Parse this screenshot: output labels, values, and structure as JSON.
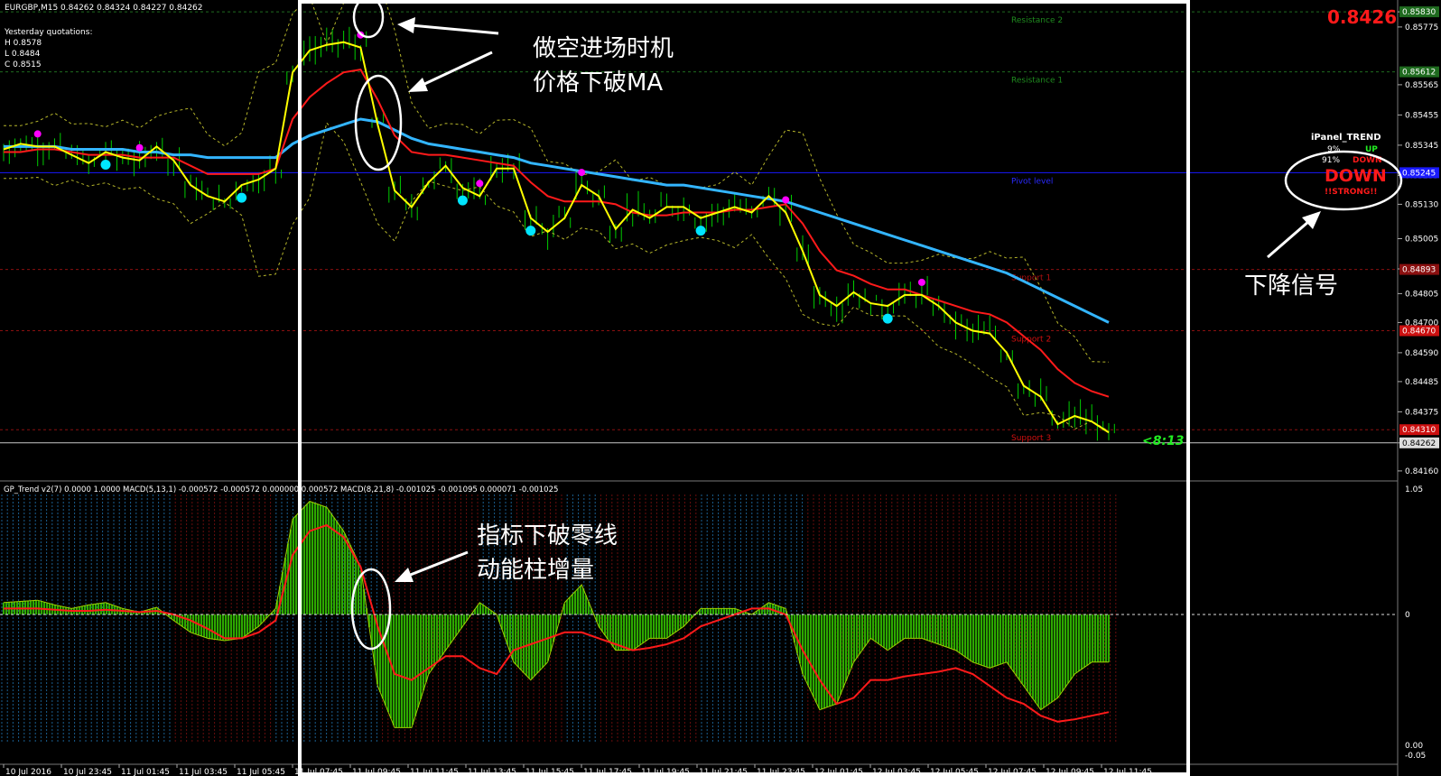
{
  "header": {
    "symbol_line": "EURGBP,M15  0.84262 0.84324 0.84227 0.84262",
    "yesterday_title": "Yesterday quotations:",
    "yesterday_h": "H 0.8578",
    "yesterday_l": "L 0.8484",
    "yesterday_c": "C 0.8515"
  },
  "price_panel": {
    "current_price_big": "0.8426",
    "countdown": "<8:13",
    "axis_ticks": [
      "0.85830",
      "0.85775",
      "0.85565",
      "0.85455",
      "0.85345",
      "0.85235",
      "0.85130",
      "0.85005",
      "0.84895",
      "0.84805",
      "0.84700",
      "0.84590",
      "0.84485",
      "0.84375",
      "0.84262",
      "0.84160"
    ],
    "axis_highlight_labels": [
      "0.85830",
      "0.85612",
      "0.85245",
      "0.84893",
      "0.84670",
      "0.84310",
      "0.84262"
    ],
    "levels": [
      {
        "name": "Resistance 2",
        "value": 0.8583,
        "color": "#1f6b1f",
        "label_color": "#1f8a1f",
        "line": "dashed"
      },
      {
        "name": "Resistance 1",
        "value": 0.85612,
        "color": "#1f6b1f",
        "label_color": "#1f8a1f",
        "line": "dashed"
      },
      {
        "name": "Pivot level",
        "value": 0.85245,
        "color": "#1a1aff",
        "label_color": "#2a2aff",
        "line": "solid"
      },
      {
        "name": "Support 1",
        "value": 0.84893,
        "color": "#8a1010",
        "label_color": "#b01010",
        "line": "dashed"
      },
      {
        "name": "Support 2",
        "value": 0.8467,
        "color": "#8a1010",
        "label_color": "#d01010",
        "line": "dashed"
      },
      {
        "name": "Support 3",
        "value": 0.8431,
        "color": "#8a1010",
        "label_color": "#d01010",
        "line": "dashed"
      }
    ],
    "current_price_value": 0.84262
  },
  "ipanel": {
    "title": "iPanel_TREND",
    "up_pct": "9%",
    "up_label": "UP",
    "down_pct": "91%",
    "down_label": "DOWN",
    "big_signal": "DOWN",
    "strength": "!!STRONG!!"
  },
  "annotations": {
    "entry_line1": "做空进场时机",
    "entry_line2": "价格下破MA",
    "signal": "下降信号",
    "macd_line1": "指标下破零线",
    "macd_line2": "动能柱增量"
  },
  "macd_panel": {
    "title": "GP_Trend v2(7) 0.0000 1.0000  MACD(5,13,1) -0.000572 -0.000572 0.000000 0.000572  MACD(8,21,8) -0.001025 -0.001095 0.000071 -0.001025",
    "axis_labels": [
      "1.05",
      "0",
      "0.00",
      "-0.05"
    ]
  },
  "time_axis": [
    "10 Jul 2016",
    "10 Jul 23:45",
    "11 Jul 01:45",
    "11 Jul 03:45",
    "11 Jul 05:45",
    "11 Jul 07:45",
    "11 Jul 09:45",
    "11 Jul 11:45",
    "11 Jul 13:45",
    "11 Jul 15:45",
    "11 Jul 17:45",
    "11 Jul 19:45",
    "11 Jul 21:45",
    "11 Jul 23:45",
    "12 Jul 01:45",
    "12 Jul 03:45",
    "12 Jul 05:45",
    "12 Jul 07:45",
    "12 Jul 09:45",
    "12 Jul 11:45"
  ],
  "chart_data": {
    "type": "line",
    "symbol": "EURGBP",
    "timeframe": "M15",
    "ylim": [
      0.8414,
      0.8586
    ],
    "series": [
      {
        "values": [
          0.8533,
          0.8535,
          0.8534,
          0.8534,
          0.8531,
          0.8528,
          0.8532,
          0.853,
          0.8529,
          0.8534,
          0.8529,
          0.852,
          0.8516,
          0.8514,
          0.852,
          0.8522,
          0.8526,
          0.8561,
          0.8569,
          0.8571,
          0.8572,
          0.857,
          0.8542,
          0.8518,
          0.8512,
          0.8521,
          0.8527,
          0.8519,
          0.8516,
          0.8526,
          0.8526,
          0.8508,
          0.8503,
          0.8508,
          0.852,
          0.8516,
          0.8504,
          0.8511,
          0.8508,
          0.8512,
          0.8512,
          0.8508,
          0.851,
          0.8512,
          0.851,
          0.8516,
          0.851,
          0.8496,
          0.848,
          0.8476,
          0.8481,
          0.8477,
          0.8476,
          0.848,
          0.848,
          0.8476,
          0.847,
          0.8467,
          0.8466,
          0.8459,
          0.8447,
          0.8443,
          0.8433,
          0.8436,
          0.8434,
          0.843
        ]
      },
      {
        "values": [
          0.8532,
          0.8532,
          0.8533,
          0.8533,
          0.8532,
          0.8531,
          0.8531,
          0.8531,
          0.853,
          0.853,
          0.853,
          0.8527,
          0.8524,
          0.8524,
          0.8524,
          0.8524,
          0.8526,
          0.8544,
          0.8552,
          0.8557,
          0.8561,
          0.8562,
          0.8551,
          0.8538,
          0.8532,
          0.8531,
          0.8531,
          0.853,
          0.8529,
          0.8528,
          0.8527,
          0.8521,
          0.8516,
          0.8514,
          0.8514,
          0.8514,
          0.8513,
          0.851,
          0.8509,
          0.8509,
          0.851,
          0.851,
          0.851,
          0.8511,
          0.8511,
          0.8512,
          0.8513,
          0.8506,
          0.8496,
          0.8489,
          0.8487,
          0.8484,
          0.8482,
          0.8482,
          0.848,
          0.8478,
          0.8476,
          0.8474,
          0.8473,
          0.847,
          0.8465,
          0.846,
          0.8453,
          0.8448,
          0.8445,
          0.8443
        ]
      },
      {
        "values": [
          0.8534,
          0.8534,
          0.8534,
          0.8534,
          0.8533,
          0.8533,
          0.8533,
          0.8533,
          0.8532,
          0.8532,
          0.8531,
          0.8531,
          0.853,
          0.853,
          0.853,
          0.853,
          0.853,
          0.8535,
          0.8538,
          0.854,
          0.8542,
          0.8544,
          0.8543,
          0.854,
          0.8537,
          0.8535,
          0.8534,
          0.8533,
          0.8532,
          0.8531,
          0.853,
          0.8528,
          0.8527,
          0.8526,
          0.8525,
          0.8524,
          0.8523,
          0.8522,
          0.8521,
          0.852,
          0.852,
          0.8519,
          0.8518,
          0.8517,
          0.8516,
          0.8515,
          0.8514,
          0.8512,
          0.851,
          0.8508,
          0.8506,
          0.8504,
          0.8502,
          0.85,
          0.8498,
          0.8496,
          0.8494,
          0.8492,
          0.849,
          0.8488,
          0.8485,
          0.8482,
          0.8479,
          0.8476,
          0.8473,
          0.847
        ]
      },
      {
        "values": [
          0.1,
          0.11,
          0.12,
          0.08,
          0.05,
          0.08,
          0.1,
          0.05,
          0.02,
          0.06,
          -0.05,
          -0.15,
          -0.2,
          -0.22,
          -0.2,
          -0.1,
          0.05,
          0.8,
          0.95,
          0.9,
          0.7,
          0.4,
          -0.6,
          -0.95,
          -0.95,
          -0.5,
          -0.3,
          -0.1,
          0.1,
          0.0,
          -0.4,
          -0.55,
          -0.4,
          0.1,
          0.25,
          -0.1,
          -0.3,
          -0.3,
          -0.2,
          -0.2,
          -0.1,
          0.05,
          0.05,
          0.05,
          0.0,
          0.1,
          0.05,
          -0.5,
          -0.8,
          -0.75,
          -0.4,
          -0.2,
          -0.3,
          -0.2,
          -0.2,
          -0.25,
          -0.3,
          -0.4,
          -0.45,
          -0.4,
          -0.6,
          -0.8,
          -0.7,
          -0.5,
          -0.4,
          -0.4
        ]
      },
      {
        "values": [
          0.05,
          0.05,
          0.05,
          0.04,
          0.03,
          0.03,
          0.04,
          0.03,
          0.02,
          0.03,
          0.0,
          -0.05,
          -0.12,
          -0.2,
          -0.2,
          -0.15,
          -0.05,
          0.5,
          0.7,
          0.75,
          0.65,
          0.4,
          -0.1,
          -0.5,
          -0.55,
          -0.45,
          -0.35,
          -0.35,
          -0.45,
          -0.5,
          -0.3,
          -0.25,
          -0.2,
          -0.15,
          -0.15,
          -0.2,
          -0.25,
          -0.3,
          -0.28,
          -0.25,
          -0.2,
          -0.1,
          -0.05,
          0.0,
          0.05,
          0.05,
          0.0,
          -0.3,
          -0.55,
          -0.75,
          -0.7,
          -0.55,
          -0.55,
          -0.52,
          -0.5,
          -0.48,
          -0.45,
          -0.5,
          -0.6,
          -0.7,
          -0.75,
          -0.85,
          -0.9,
          -0.88,
          -0.85,
          -0.82
        ]
      }
    ]
  },
  "colors": {
    "background": "#000000",
    "price_bars": "#00cc00",
    "fast_ma": "#ffff00",
    "mid_ma": "#ff1a1a",
    "slow_ma": "#33b5ff",
    "bands": "#b5b52a",
    "dot_cyan": "#00e5ff",
    "dot_magenta": "#ff00ff",
    "hist_fill": "#2da800",
    "frame": "#ffffff"
  }
}
